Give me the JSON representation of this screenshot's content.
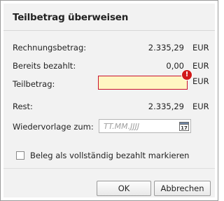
{
  "dialog": {
    "title": "Teilbetrag überweisen"
  },
  "rows": {
    "rechnungsbetrag": {
      "label": "Rechnungsbetrag:",
      "value": "2.335,29",
      "currency": "EUR"
    },
    "bereits_bezahlt": {
      "label": "Bereits bezahlt:",
      "value": "0,00",
      "currency": "EUR"
    },
    "teilbetrag": {
      "label": "Teilbetrag:",
      "value": "",
      "currency": "EUR",
      "error_icon": "!"
    },
    "rest": {
      "label": "Rest:",
      "value": "2.335,29",
      "currency": "EUR"
    },
    "wiedervorlage": {
      "label": "Wiedervorlage zum:",
      "placeholder": "TT.MM.JJJJ",
      "calendar_day": "17"
    }
  },
  "checkbox": {
    "label": "Beleg als vollständig bezahlt markieren",
    "checked": false
  },
  "buttons": {
    "ok": "OK",
    "cancel": "Abbrechen"
  },
  "colors": {
    "error": "#d11a1a",
    "invalid_field_bg": "#fff6c2",
    "invalid_border": "#c8102e"
  },
  "icons": {
    "error": "exclamation-circle-icon",
    "calendar": "calendar-icon"
  }
}
